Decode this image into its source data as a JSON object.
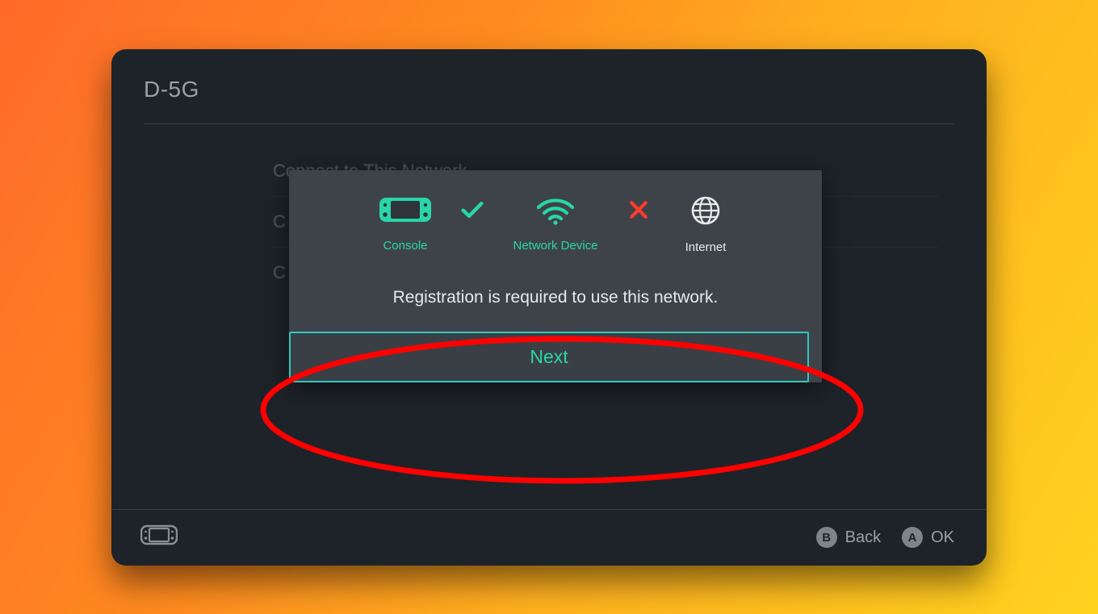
{
  "header": {
    "title": "D-5G"
  },
  "bg_menu": {
    "items": [
      {
        "label": "Connect to This Network"
      },
      {
        "label": "C"
      },
      {
        "label": "C"
      }
    ]
  },
  "dialog": {
    "nodes": {
      "console": {
        "label": "Console"
      },
      "network_device": {
        "label": "Network Device"
      },
      "internet": {
        "label": "Internet"
      }
    },
    "link_console_network": "ok",
    "link_network_internet": "fail",
    "message": "Registration is required to use this network.",
    "next_label": "Next"
  },
  "footer": {
    "back": {
      "glyph": "B",
      "label": "Back"
    },
    "ok": {
      "glyph": "A",
      "label": "OK"
    }
  },
  "colors": {
    "accent_teal": "#28d6a9",
    "error_red": "#ff3b30",
    "annotation_red": "#ff0000"
  }
}
